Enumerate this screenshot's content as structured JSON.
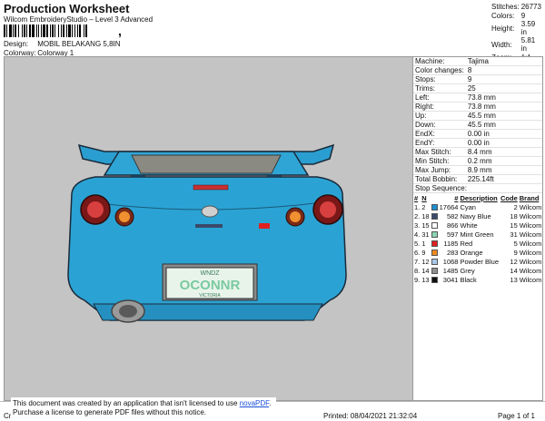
{
  "header": {
    "title": "Production Worksheet",
    "subtitle": "Wilcom EmbroideryStudio – Level 3 Advanced",
    "barcode_tail": ",",
    "design_label": "Design:",
    "design_value": "MOBIL BELAKANG 5,8IN",
    "colorway_label": "Colorway:",
    "colorway_value": "Colorway 1"
  },
  "stats": [
    {
      "k": "Stitches:",
      "v": "26773"
    },
    {
      "k": "Colors:",
      "v": "9"
    },
    {
      "k": "Height:",
      "v": "3.59 in"
    },
    {
      "k": "Width:",
      "v": "5.81 in"
    },
    {
      "k": "Zoom:",
      "v": "1:1"
    }
  ],
  "info": [
    {
      "k": "Machine:",
      "v": "Tajima"
    },
    {
      "k": "Color changes:",
      "v": "8"
    },
    {
      "k": "Stops:",
      "v": "9"
    },
    {
      "k": "Trims:",
      "v": "25"
    },
    {
      "k": "Left:",
      "v": "73.8 mm"
    },
    {
      "k": "Right:",
      "v": "73.8 mm"
    },
    {
      "k": "Up:",
      "v": "45.5 mm"
    },
    {
      "k": "Down:",
      "v": "45.5 mm"
    },
    {
      "k": "EndX:",
      "v": "0.00 in"
    },
    {
      "k": "EndY:",
      "v": "0.00 in"
    },
    {
      "k": "Max Stitch:",
      "v": "8.4 mm"
    },
    {
      "k": "Min Stitch:",
      "v": "0.2 mm"
    },
    {
      "k": "Max Jump:",
      "v": "8.9 mm"
    },
    {
      "k": "Total Bobbin:",
      "v": "225.14ft"
    }
  ],
  "sequence": {
    "title": "Stop Sequence:",
    "headers": {
      "num": "#",
      "n": "N",
      "st": "#",
      "desc": "Description",
      "code": "Code",
      "brand": "Brand"
    },
    "rows": [
      {
        "num": "1.",
        "n": "2",
        "color": "#1e8fd0",
        "st": "17664",
        "desc": "Cyan",
        "code": "2",
        "brand": "Wilcom"
      },
      {
        "num": "2.",
        "n": "18",
        "color": "#3a4a6a",
        "st": "582",
        "desc": "Navy Blue",
        "code": "18",
        "brand": "Wilcom"
      },
      {
        "num": "3.",
        "n": "15",
        "color": "#ffffff",
        "st": "866",
        "desc": "White",
        "code": "15",
        "brand": "Wilcom"
      },
      {
        "num": "4.",
        "n": "31",
        "color": "#8ad4b0",
        "st": "597",
        "desc": "Mint Green",
        "code": "31",
        "brand": "Wilcom"
      },
      {
        "num": "5.",
        "n": "1",
        "color": "#e02020",
        "st": "1185",
        "desc": "Red",
        "code": "5",
        "brand": "Wilcom"
      },
      {
        "num": "6.",
        "n": "9",
        "color": "#f08a20",
        "st": "283",
        "desc": "Orange",
        "code": "9",
        "brand": "Wilcom"
      },
      {
        "num": "7.",
        "n": "12",
        "color": "#a8c8e8",
        "st": "1068",
        "desc": "Powder Blue",
        "code": "12",
        "brand": "Wilcom"
      },
      {
        "num": "8.",
        "n": "14",
        "color": "#909090",
        "st": "1485",
        "desc": "Grey",
        "code": "14",
        "brand": "Wilcom"
      },
      {
        "num": "9.",
        "n": "13",
        "color": "#111111",
        "st": "3041",
        "desc": "Black",
        "code": "13",
        "brand": "Wilcom"
      }
    ]
  },
  "design": {
    "plate_top": "WNDZ",
    "plate_main": "OCONNR",
    "plate_bottom": "VICTORIA"
  },
  "footer": {
    "cr": "Cr",
    "printed": "Printed: 08/04/2021 21:32:04",
    "page": "Page 1 of 1"
  },
  "notice": {
    "line1_pre": "This document was created by an application that isn't licensed to use ",
    "link": "novaPDF",
    "line1_post": ".",
    "line2": "Purchase a license to generate PDF files without this notice."
  }
}
